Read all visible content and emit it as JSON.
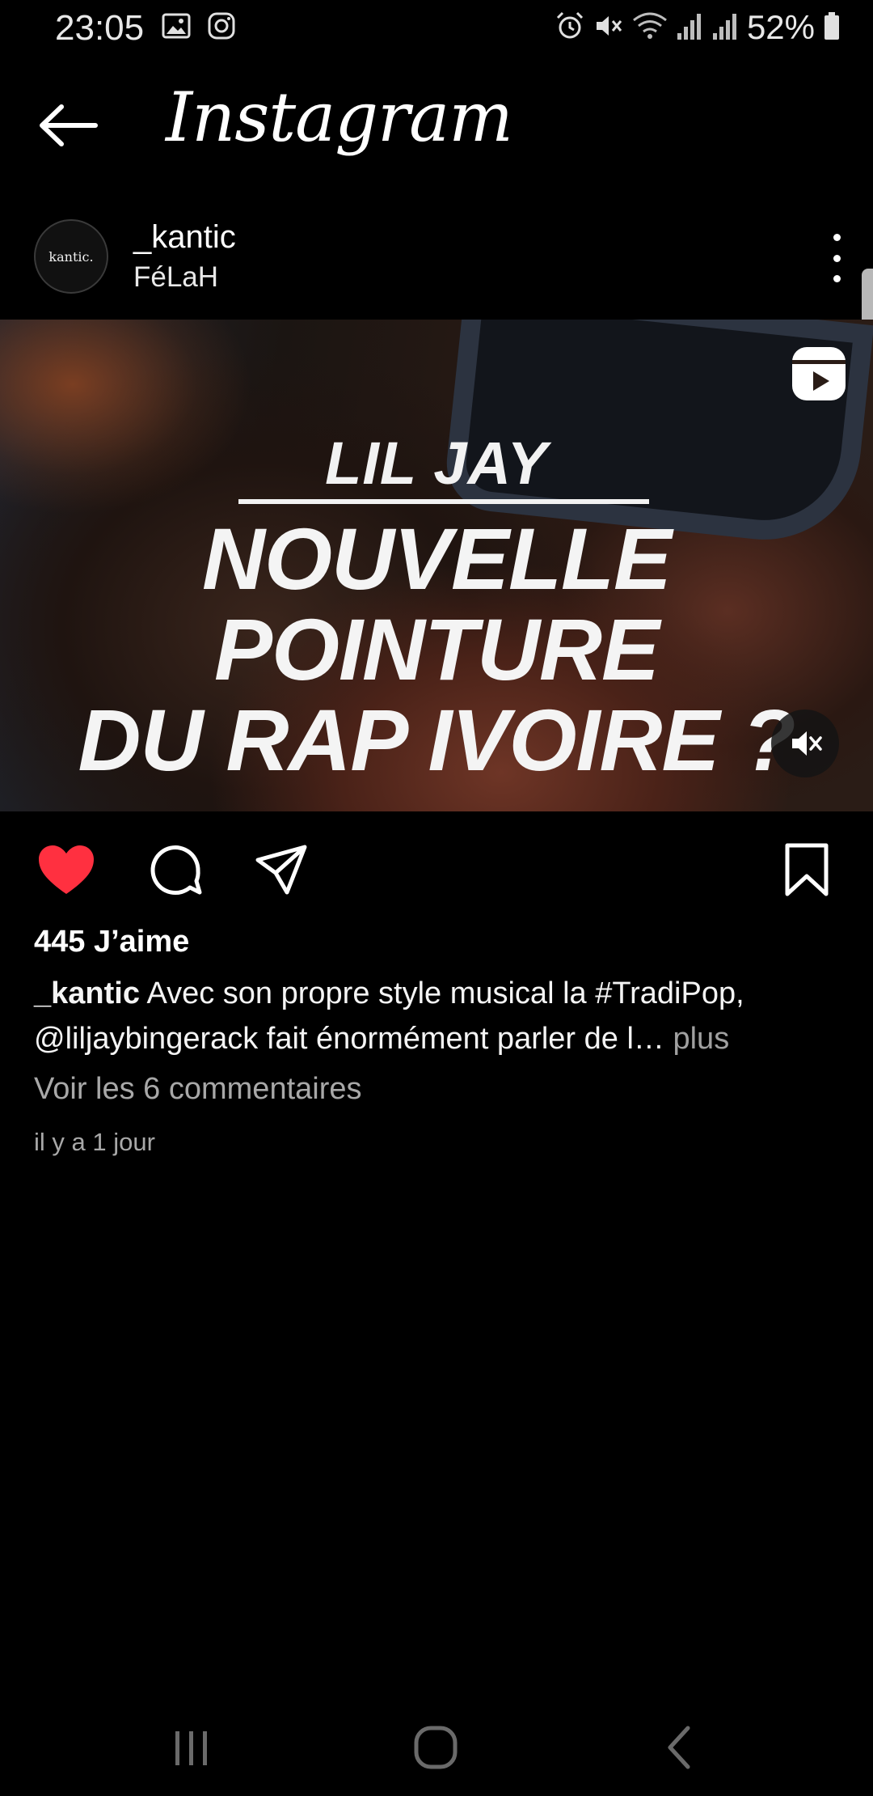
{
  "status_bar": {
    "time": "23:05",
    "battery": "52%",
    "left_icons": [
      "image-icon",
      "instagram-icon"
    ],
    "right_icons": [
      "alarm-icon",
      "mute-icon",
      "wifi-icon",
      "signal-icon",
      "signal-icon",
      "battery-icon"
    ]
  },
  "app_bar": {
    "title": "Instagram"
  },
  "post": {
    "username": "_kantic",
    "subtitle": "FéLaH",
    "avatar_text": "kantic.",
    "media": {
      "overlay_title": "LIL JAY",
      "overlay_headline_line1": "NOUVELLE POINTURE",
      "overlay_headline_line2": "DU RAP IVOIRE ?"
    },
    "likes": "445 J’aime",
    "caption_user": "_kantic",
    "caption_text": "Avec son propre style musical la #TradiPop, @liljaybingerack fait énormément parler de l…",
    "caption_more": "plus",
    "comments_link": "Voir les 6 commentaires",
    "timestamp": "il y a 1 jour"
  },
  "colors": {
    "background": "#000000",
    "like_active": "#ff3040",
    "secondary_text": "#a8a8a8"
  }
}
